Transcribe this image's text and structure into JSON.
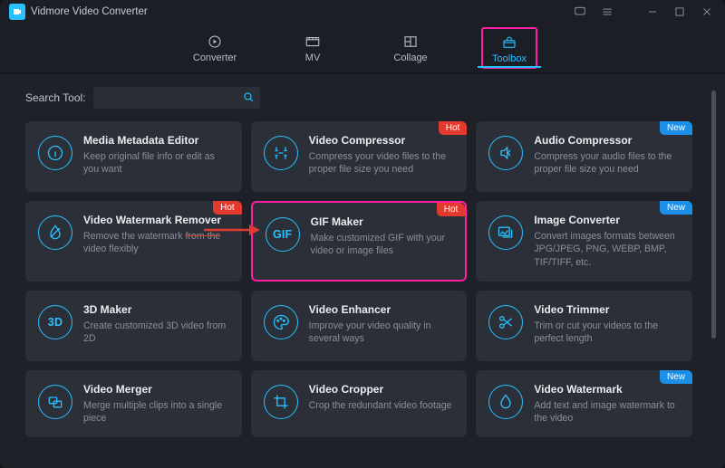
{
  "header": {
    "title": "Vidmore Video Converter"
  },
  "tabs": [
    {
      "label": "Converter"
    },
    {
      "label": "MV"
    },
    {
      "label": "Collage"
    },
    {
      "label": "Toolbox",
      "active": true,
      "highlighted": true
    }
  ],
  "search": {
    "label": "Search Tool:",
    "placeholder": "",
    "value": ""
  },
  "badges": {
    "hot": "Hot",
    "new": "New"
  },
  "tools": [
    {
      "title": "Media Metadata Editor",
      "desc": "Keep original file info or edit as you want"
    },
    {
      "title": "Video Compressor",
      "desc": "Compress your video files to the proper file size you need",
      "badge": "hot"
    },
    {
      "title": "Audio Compressor",
      "desc": "Compress your audio files to the proper file size you need",
      "badge": "new"
    },
    {
      "title": "Video Watermark Remover",
      "desc_pre": "Remove the watermark ",
      "desc_strike": "from the",
      "desc_post": " video flexibly",
      "badge": "hot"
    },
    {
      "title": "GIF Maker",
      "icon_text": "GIF",
      "desc": "Make customized GIF with your video or image files",
      "badge": "hot",
      "highlighted": true
    },
    {
      "title": "Image Converter",
      "desc": "Convert images formats between JPG/JPEG, PNG, WEBP, BMP, TIF/TIFF, etc.",
      "badge": "new"
    },
    {
      "title": "3D Maker",
      "icon_text": "3D",
      "desc": "Create customized 3D video from 2D"
    },
    {
      "title": "Video Enhancer",
      "desc": "Improve your video quality in several ways"
    },
    {
      "title": "Video Trimmer",
      "desc": "Trim or cut your videos to the perfect length"
    },
    {
      "title": "Video Merger",
      "desc": "Merge multiple clips into a single piece"
    },
    {
      "title": "Video Cropper",
      "desc": "Crop the redundant video footage"
    },
    {
      "title": "Video Watermark",
      "desc": "Add text and image watermark to the video",
      "badge": "new"
    }
  ],
  "colors": {
    "accent": "#29c0ff",
    "highlight": "#ff1fa5",
    "hot_badge": "#e23a2e",
    "new_badge": "#1e8fe6",
    "background": "#1e2128",
    "panel": "#2b2f38"
  }
}
